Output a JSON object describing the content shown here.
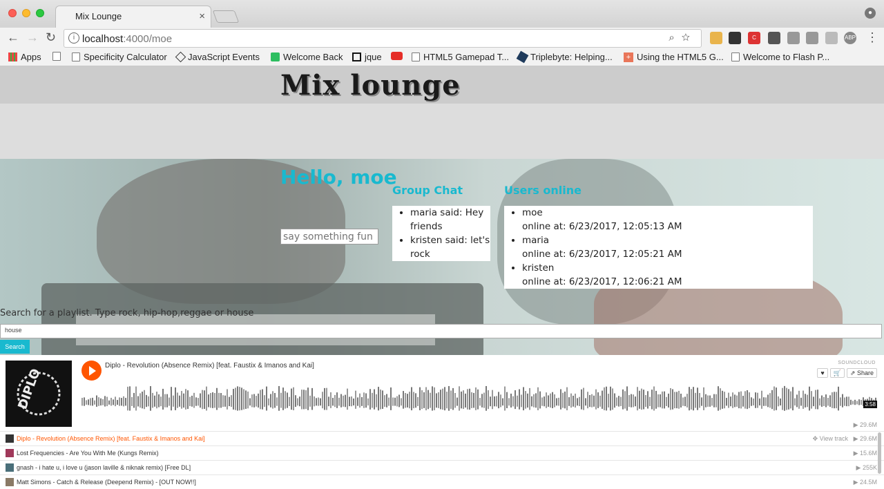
{
  "browser": {
    "tab_title": "Mix Lounge",
    "tab_close": "×",
    "url_host": "localhost",
    "url_rest": ":4000/moe",
    "bookmarks": [
      "Apps",
      "Specificity Calculator",
      "JavaScript Events",
      "Welcome Back",
      "jque",
      "",
      "HTML5 Gamepad T...",
      "Triplebyte: Helping...",
      "Using the HTML5 G...",
      "Welcome to Flash P..."
    ]
  },
  "site": {
    "logo": "Mix lounge",
    "greeting": "Hello, moe",
    "chat_placeholder": "say something fun",
    "group_chat_title": "Group Chat",
    "messages": [
      "maria said: Hey friends",
      "kristen said: let's rock"
    ],
    "users_title": "Users online",
    "users": [
      {
        "name": "moe",
        "online": "online at: 6/23/2017, 12:05:13 AM"
      },
      {
        "name": "maria",
        "online": "online at: 6/23/2017, 12:05:21 AM"
      },
      {
        "name": "kristen",
        "online": "online at: 6/23/2017, 12:06:21 AM"
      }
    ],
    "search_label": "Search for a playlist. Type rock, hip-hop,reggae or house",
    "search_value": "house",
    "search_button": "Search"
  },
  "player": {
    "brand": "SOUNDCLOUD",
    "current_title": "Diplo - Revolution (Absence Remix) [feat. Faustix & Imanos and Kai]",
    "share": "Share",
    "duration": "3:58",
    "plays": "▶ 29.6M",
    "tracks": [
      {
        "title": "Diplo - Revolution (Absence Remix) [feat. Faustix & Imanos and Kai]",
        "plays": "▶ 29.6M",
        "view": "View track",
        "thumb": "#333333",
        "active": true
      },
      {
        "title": "Lost Frequencies - Are You With Me (Kungs Remix)",
        "plays": "▶ 15.6M",
        "view": "",
        "thumb": "#a0395a",
        "active": false
      },
      {
        "title": "gnash - i hate u, i love u (jason laville & niknak remix) [Free DL]",
        "plays": "▶ 255K",
        "view": "",
        "thumb": "#4a6f7a",
        "active": false
      },
      {
        "title": "Matt Simons - Catch & Release (Deepend Remix) - [OUT NOW!!]",
        "plays": "▶ 24.5M",
        "view": "",
        "thumb": "#8a7a66",
        "active": false
      }
    ]
  },
  "colors": {
    "accent": "#19b9cf",
    "soundcloud": "#ff5500"
  }
}
